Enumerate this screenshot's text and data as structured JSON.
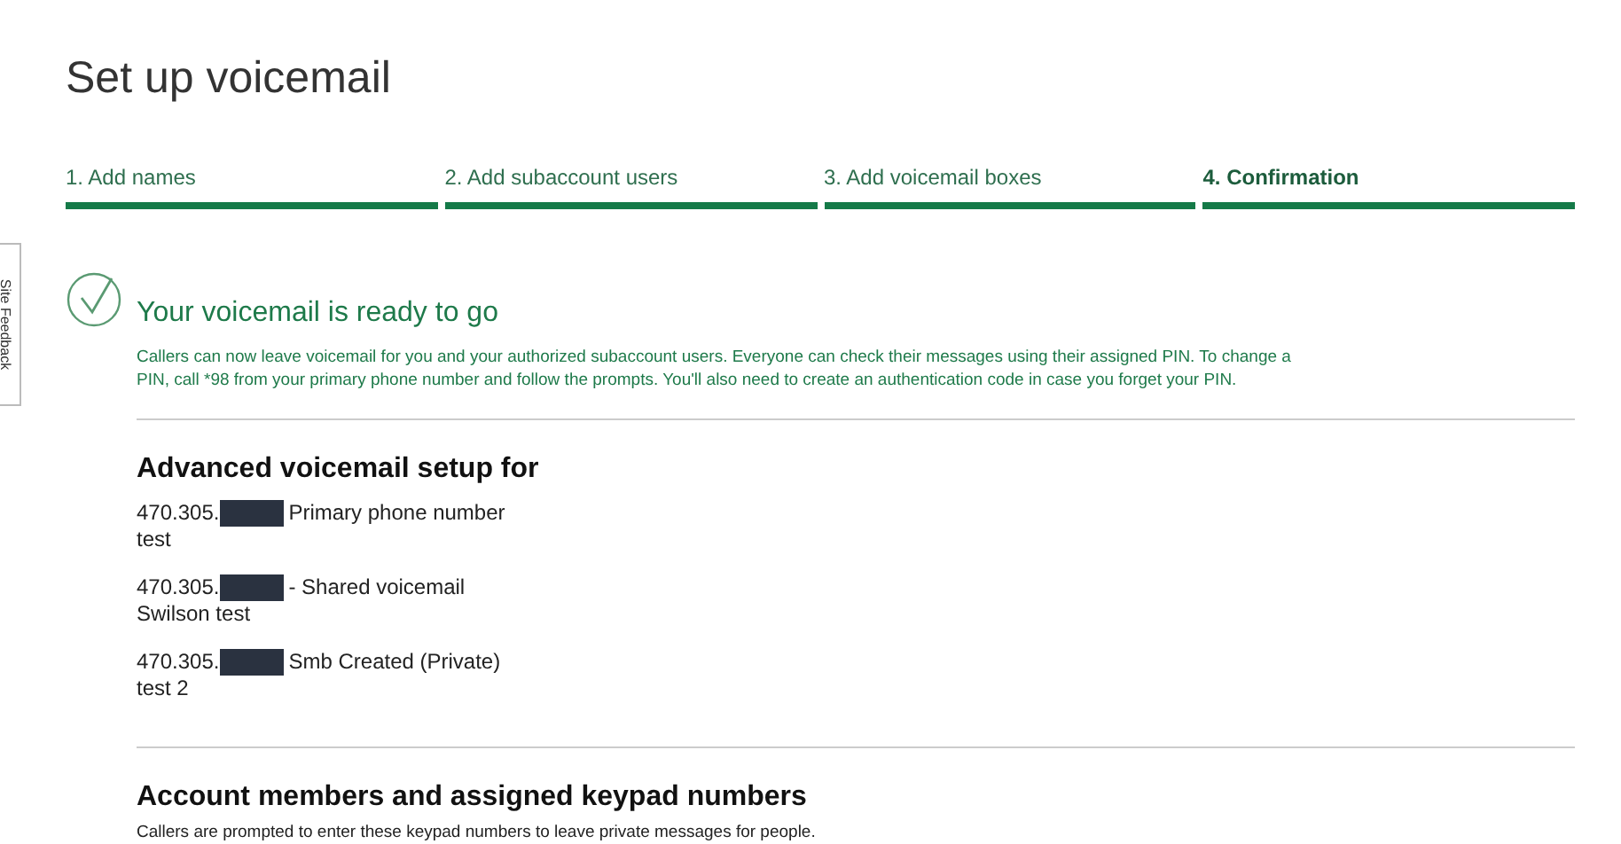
{
  "feedback_tab": {
    "label": "Site Feedback"
  },
  "title": "Set up voicemail",
  "steps": [
    {
      "label": "1. Add names",
      "selected": false
    },
    {
      "label": "2. Add subaccount users",
      "selected": false
    },
    {
      "label": "3. Add voicemail boxes",
      "selected": false
    },
    {
      "label": "4. Confirmation",
      "selected": true
    }
  ],
  "success": {
    "heading": "Your voicemail is ready to go",
    "text": "Callers can now leave voicemail for you and your authorized subaccount users. Everyone can check their messages using their assigned PIN. To change a PIN, call *98 from your primary phone number and follow the prompts. You'll also need to create an authentication code in case you forget your PIN."
  },
  "advanced": {
    "heading": "Advanced voicemail setup for",
    "entries": [
      {
        "number": "470.305.",
        "description": "Primary phone number",
        "name": "test"
      },
      {
        "number": "470.305.",
        "description": "- Shared voicemail",
        "name": "Swilson test"
      },
      {
        "number": "470.305.",
        "description": "Smb Created (Private)",
        "name": "test 2"
      }
    ]
  },
  "members": {
    "heading": "Account members and assigned keypad numbers",
    "text": "Callers are prompted to enter these keypad numbers to leave private messages for people."
  }
}
